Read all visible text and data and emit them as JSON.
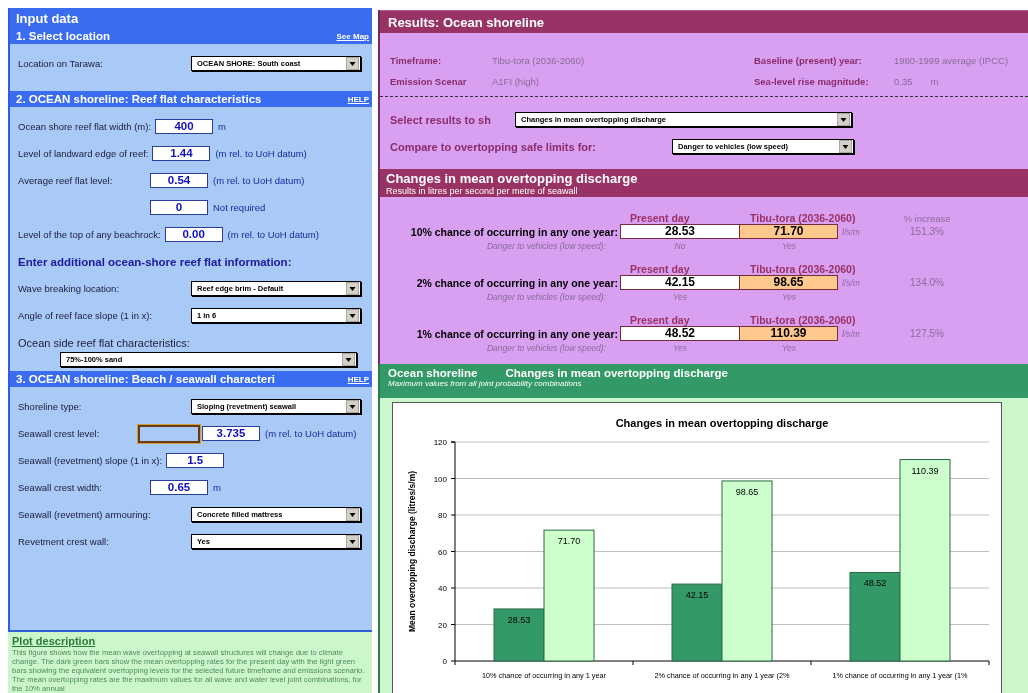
{
  "input": {
    "title": "Input data",
    "sections": [
      {
        "heading": "1. Select location",
        "link": "See Map",
        "rows": [
          {
            "kind": "dropdown",
            "label": "Location on Tarawa:",
            "value": "OCEAN SHORE: South coast"
          }
        ]
      },
      {
        "heading": "2. OCEAN shoreline: Reef flat characteristics",
        "link": "HELP",
        "rows": [
          {
            "kind": "number",
            "label": "Ocean shore reef flat width (m):",
            "value": "400",
            "unit": "m",
            "cell_selected": false
          },
          {
            "kind": "number",
            "label": "Level of landward edge of reef:",
            "value": "1.44",
            "unit": "(m rel. to UoH datum)",
            "cell_selected": false
          },
          {
            "kind": "number",
            "label": "Average reef flat level:",
            "value": "0.54",
            "unit": "(m rel. to UoH datum)",
            "cell_selected": false
          },
          {
            "kind": "number",
            "value": "0",
            "unit": "Not required",
            "cell_selected": false
          },
          {
            "kind": "number",
            "label": "Level of the top of any beachrock:",
            "value": "0.00",
            "unit": "(m rel. to UoH datum)",
            "cell_selected": false
          },
          {
            "kind": "subheading",
            "label": "Enter additional ocean-shore reef flat information:"
          },
          {
            "kind": "dropdown",
            "label": "Wave breaking location:",
            "value": "Reef edge brim - Default"
          },
          {
            "kind": "dropdown",
            "label": "Angle of reef face slope (1 in x):",
            "value": "1 in 6"
          },
          {
            "kind": "dropdown_wide",
            "label": "Ocean side reef flat characteristics:",
            "value": "75%-100% sand"
          }
        ]
      },
      {
        "heading": "3. OCEAN shoreline: Beach / seawall characteri",
        "link": "HELP",
        "rows": [
          {
            "kind": "dropdown",
            "label": "Shoreline type:",
            "value": "Sloping (revetment) seawall"
          },
          {
            "kind": "number",
            "label": "Seawall crest level:",
            "value": "3.735",
            "unit": "(m rel. to UoH datum)",
            "cell_selected": true
          },
          {
            "kind": "number",
            "label": "Seawall (revetment) slope (1 in x):",
            "value": "1.5",
            "cell_selected": false
          },
          {
            "kind": "number",
            "label": "Seawall crest width:",
            "value": "0.65",
            "unit": "m",
            "cell_selected": false
          },
          {
            "kind": "dropdown",
            "label": "Seawall (revetment) armouring:",
            "value": "Concrete filled mattress"
          },
          {
            "kind": "dropdown",
            "label": "Revetment crest wall:",
            "value": "Yes"
          }
        ]
      }
    ]
  },
  "plot_description": {
    "title": "Plot description",
    "text": "This figure shows how the mean wave overtopping at seawall structures will change due to climate change. The dark green bars show the mean overtopping rates for the present day with the light green bars showing the equivalent overtopping levels for the selected future timeframe and emissions scenario. The mean overtopping rates are the maximum values for all wave and water level joint combinations, for the 10% annual"
  },
  "results": {
    "title": "Results: Ocean shoreline",
    "info": [
      {
        "label": "Timeframe:",
        "value": "Tibu-tora (2036-2060)"
      },
      {
        "label": "Baseline (present) year:",
        "value": "1980-1999 average (IPCC)"
      },
      {
        "label": "Emission Scenar",
        "value": "A1FI (high)"
      },
      {
        "label": "Sea-level rise magnitude:",
        "value": "0.35",
        "unit": "m"
      }
    ],
    "selectors": [
      {
        "label": "Select results to sh",
        "value": "Changes in mean overtopping discharge"
      },
      {
        "label": "Compare to overtopping safe limits for:",
        "value": "Danger to vehicles (low speed)"
      }
    ],
    "section": {
      "title": "Changes in mean overtopping discharge",
      "subtitle": "Results in litres per second per metre of seawall"
    },
    "rows": [
      {
        "present_heading": "Present day",
        "future_heading": "Tibu-tora (2036-2060)",
        "increase_heading": "% increase",
        "label": "10% chance of occurring in any one year:",
        "present": "28.53",
        "future": "71.70",
        "unit": "l/s/m",
        "increase": "151.3%",
        "danger_label": "Danger to vehicles (low speed):",
        "present_danger": "No",
        "future_danger": "Yes"
      },
      {
        "present_heading": "Present day",
        "future_heading": "Tibu-tora (2036-2060)",
        "label": "2% chance of occurring in any one year:",
        "present": "42.15",
        "future": "98.65",
        "unit": "l/s/m",
        "increase": "134.0%",
        "danger_label": "Danger to vehicles (low speed):",
        "present_danger": "Yes",
        "future_danger": "Yes"
      },
      {
        "present_heading": "Present day",
        "future_heading": "Tibu-tora (2036-2060)",
        "label": "1% chance of occurring in any one year:",
        "present": "48.52",
        "future": "110.39",
        "unit": "l/s/m",
        "increase": "127.5%",
        "danger_label": "Danger to vehicles (low speed):",
        "present_danger": "Yes",
        "future_danger": "Yes"
      }
    ]
  },
  "chart_panel": {
    "location": "Ocean shoreline",
    "title": "Changes in mean overtopping discharge",
    "note": "Maximum values from all joint probability combinations",
    "chart_data": {
      "type": "bar",
      "title": "Changes in mean overtopping discharge",
      "ylabel": "Mean overtopping discharge (litres/s/m)",
      "categories": [
        "10% chance of occurring in any 1 year",
        "2% chance of occurring in any 1 year (2%",
        "1% chance of occurring in any 1 year (1%"
      ],
      "series": [
        {
          "color": "#339966",
          "values": [
            28.53,
            42.15,
            48.52
          ]
        },
        {
          "color": "#ccffcc",
          "values": [
            71.7,
            98.65,
            110.39
          ]
        }
      ],
      "ylim": [
        0,
        120
      ],
      "yticks": [
        0,
        20,
        40,
        60,
        80,
        100,
        120
      ],
      "grid": true,
      "value_labels": [
        [
          "28.53",
          "42.15",
          "48.52"
        ],
        [
          "71.70",
          "98.65",
          "110.39"
        ]
      ]
    }
  }
}
